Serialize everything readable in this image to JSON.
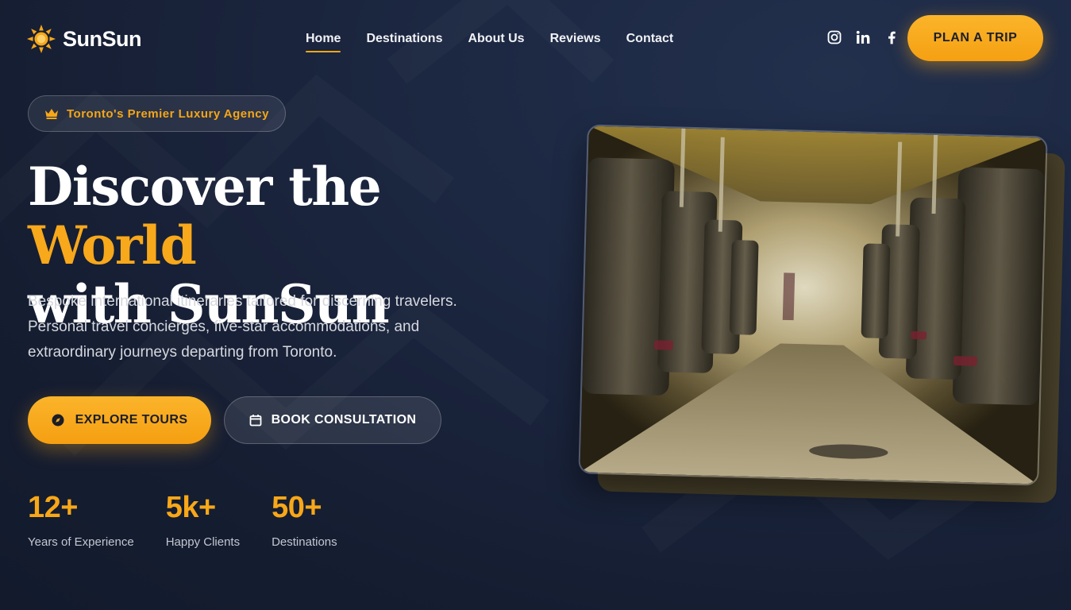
{
  "brand": {
    "name": "SunSun",
    "icon": "sun-icon",
    "color": "#f7a718"
  },
  "nav": {
    "items": [
      {
        "label": "Home",
        "active": true
      },
      {
        "label": "Destinations",
        "active": false
      },
      {
        "label": "About Us",
        "active": false
      },
      {
        "label": "Reviews",
        "active": false
      },
      {
        "label": "Contact",
        "active": false
      }
    ],
    "socials": [
      "instagram-icon",
      "linkedin-icon",
      "facebook-icon"
    ],
    "cta": "PLAN A TRIP"
  },
  "hero": {
    "badge": {
      "icon": "crown-icon",
      "text": "Toronto's Premier Luxury Agency"
    },
    "headline": {
      "part1": "Discover the ",
      "accent": "World",
      "part2": "with SunSun"
    },
    "subtext": "Bespoke international itineraries tailored for discerning travelers. Personal travel concierges, five-star accommodations, and extraordinary journeys departing from Toronto.",
    "primary_button": {
      "icon": "compass-icon",
      "label": "EXPLORE TOURS"
    },
    "secondary_button": {
      "icon": "calendar-icon",
      "label": "BOOK CONSULTATION"
    },
    "stats": [
      {
        "value": "12+",
        "label": "Years of Experience"
      },
      {
        "value": "5k+",
        "label": "Happy Clients"
      },
      {
        "value": "50+",
        "label": "Destinations"
      }
    ],
    "image": {
      "subject": "train-interior-photo"
    }
  },
  "colors": {
    "accent": "#f7a718",
    "background": "#1c2741",
    "text": "#ffffff"
  }
}
